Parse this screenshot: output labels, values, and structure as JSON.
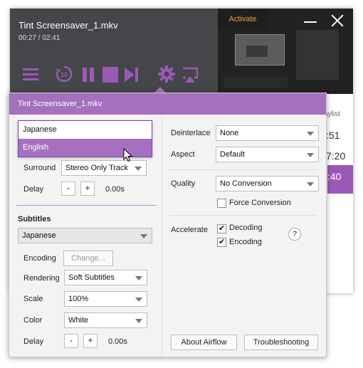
{
  "player": {
    "file_title": "Tint Screensaver_1.mkv",
    "time": "00:27 / 02:41",
    "activate_label": "Activate",
    "playlist_label": "aylist",
    "playlist_times": [
      ":51",
      "7:20",
      ":40"
    ],
    "replay_seconds": "10"
  },
  "dialog": {
    "title": "Tint Screensaver_1.mkv",
    "audio_dropdown": {
      "options": [
        "Japanese",
        "English"
      ],
      "highlighted": "English"
    },
    "audio": {
      "surround_label": "Surround",
      "surround_value": "Stereo Only Track",
      "delay_label": "Delay",
      "delay_minus": "-",
      "delay_plus": "+",
      "delay_value": "0.00s"
    },
    "subtitles": {
      "header": "Subtitles",
      "track_value": "Japanese",
      "encoding_label": "Encoding",
      "encoding_button": "Change...",
      "rendering_label": "Rendering",
      "rendering_value": "Soft Subtitles",
      "scale_label": "Scale",
      "scale_value": "100%",
      "color_label": "Color",
      "color_value": "White",
      "delay_label": "Delay",
      "delay_minus": "-",
      "delay_plus": "+",
      "delay_value": "0.00s"
    },
    "video": {
      "deinterlace_label": "Deinterlace",
      "deinterlace_value": "None",
      "aspect_label": "Aspect",
      "aspect_value": "Default",
      "quality_label": "Quality",
      "quality_value": "No Conversion",
      "force_conversion_label": "Force Conversion",
      "force_conversion_checked": false,
      "accelerate_label": "Accelerate",
      "decoding_label": "Decoding",
      "decoding_checked": true,
      "encoding_label": "Encoding",
      "encoding_checked": true,
      "help_label": "?"
    },
    "footer": {
      "about_button": "About Airflow",
      "troubleshooting_button": "Troubleshooting"
    }
  },
  "colors": {
    "accent": "#a670c0",
    "icon_purple": "#9b59b6",
    "player_bar": "#444649",
    "activate_text": "#f0a030"
  },
  "icons": [
    "playlist-icon",
    "replay-10-icon",
    "pause-icon",
    "stop-icon",
    "skip-next-icon",
    "gear-icon",
    "airplay-icon",
    "minimize-icon",
    "close-icon",
    "dropdown-arrow-icon",
    "help-icon",
    "mouse-cursor-icon"
  ]
}
